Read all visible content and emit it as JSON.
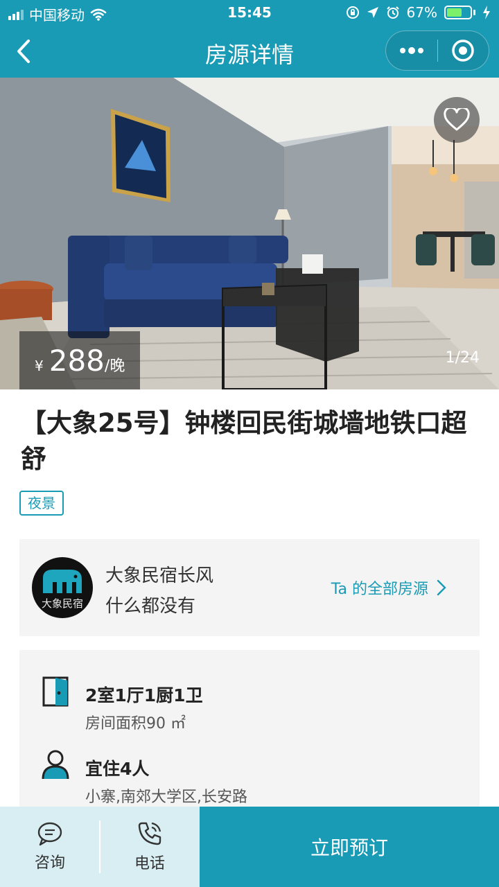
{
  "status_bar": {
    "carrier": "中国移动",
    "time": "15:45",
    "battery_percent": "67%",
    "battery_level": 0.67
  },
  "nav": {
    "title": "房源详情"
  },
  "listing": {
    "price_currency": "¥",
    "price_value": "288",
    "price_unit": "/晚",
    "photo_counter": "1/24",
    "title": "【大象25号】钟楼回民街城墙地铁口超舒",
    "tag": "夜景"
  },
  "host": {
    "avatar_text": "大象民宿",
    "name": "大象民宿长风",
    "bio": "什么都没有",
    "all_listings_link": "Ta 的全部房源"
  },
  "details": {
    "layout": "2室1厅1厨1卫",
    "area": "房间面积90 ㎡",
    "capacity": "宜住4人",
    "location": "小寨,南郊大学区,长安路"
  },
  "bottom_bar": {
    "consult_label": "咨询",
    "phone_label": "电话",
    "book_label": "立即预订"
  },
  "colors": {
    "primary": "#1a9bb5",
    "bottom_left_bg": "#d9eef2",
    "card_bg": "#f4f4f4"
  }
}
